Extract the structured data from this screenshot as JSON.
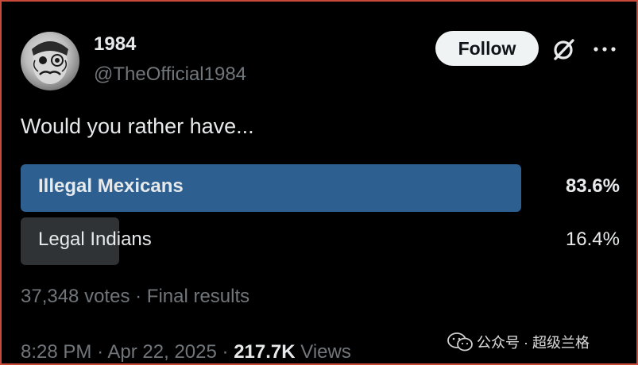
{
  "author": {
    "display_name": "1984",
    "handle": "@TheOfficial1984"
  },
  "actions": {
    "follow_label": "Follow",
    "grok_icon": "grok-icon",
    "more_icon": "more-icon"
  },
  "post": {
    "question": "Would you rather have..."
  },
  "poll": {
    "options": [
      {
        "label": "Illegal Mexicans",
        "percent": "83.6%",
        "value": 83.6,
        "winner": true
      },
      {
        "label": "Legal Indians",
        "percent": "16.4%",
        "value": 16.4,
        "winner": false
      }
    ],
    "votes": "37,348 votes",
    "status": "Final results"
  },
  "meta": {
    "time": "8:28 PM",
    "date": "Apr 22, 2025",
    "views_count": "217.7K",
    "views_label": "Views"
  },
  "watermark": {
    "text": "公众号 · 超级兰格"
  },
  "colors": {
    "winner_bar": "#2d5f91",
    "other_bar": "#2f3336",
    "text": "#e7e9ea",
    "muted": "#71767b",
    "border": "#c94a3a"
  }
}
